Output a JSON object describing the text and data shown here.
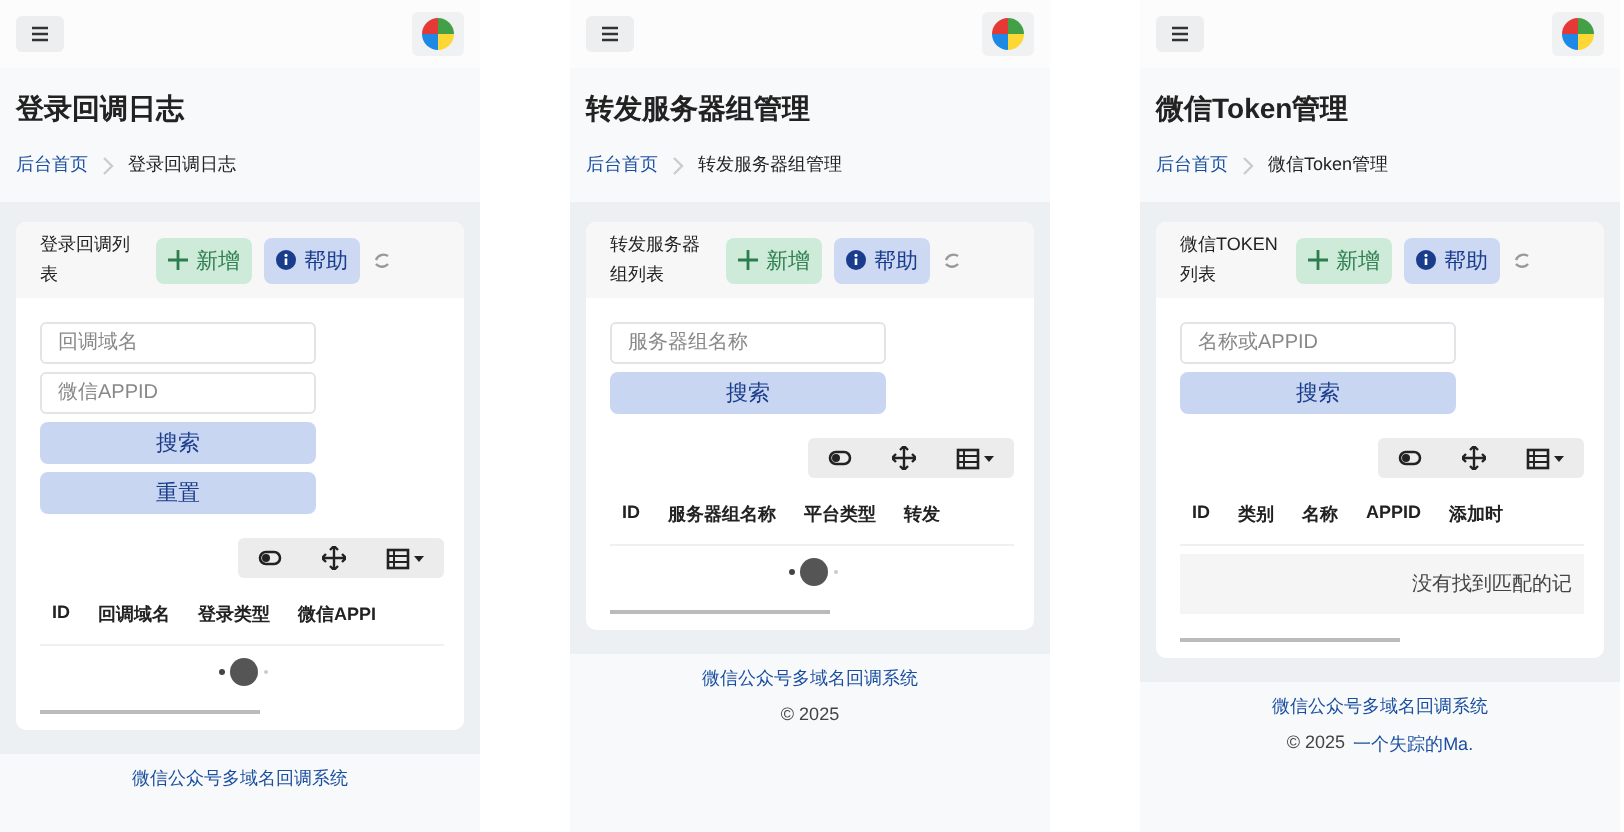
{
  "screens": [
    {
      "title": "登录回调日志",
      "breadcrumb": [
        {
          "label": "后台首页",
          "kind": "link"
        },
        {
          "label": "登录回调日志",
          "kind": "current"
        }
      ],
      "list_title": "登录回调列表",
      "add_button": "新增",
      "help_button": "帮助",
      "search_fields": [
        {
          "placeholder": "回调域名"
        },
        {
          "placeholder": "微信APPID"
        }
      ],
      "actions": [
        "搜索",
        "重置"
      ],
      "columns": [
        "ID",
        "回调域名",
        "登录类型",
        "微信APPI"
      ],
      "loading": true,
      "footer": [
        [
          {
            "text": "微信公众号多域名回调系统",
            "kind": "link"
          }
        ]
      ]
    },
    {
      "title": "转发服务器组管理",
      "breadcrumb": [
        {
          "label": "后台首页",
          "kind": "link"
        },
        {
          "label": "转发服务器组管理",
          "kind": "current"
        }
      ],
      "list_title": "转发服务器组列表",
      "add_button": "新增",
      "help_button": "帮助",
      "search_fields": [
        {
          "placeholder": "服务器组名称"
        }
      ],
      "actions": [
        "搜索"
      ],
      "columns": [
        "ID",
        "服务器组名称",
        "平台类型",
        "转发"
      ],
      "loading": true,
      "footer": [
        [
          {
            "text": "微信公众号多域名回调系统",
            "kind": "link"
          }
        ],
        [
          {
            "text": "© 2025",
            "kind": "text"
          }
        ]
      ]
    },
    {
      "title": "微信Token管理",
      "breadcrumb": [
        {
          "label": "后台首页",
          "kind": "link"
        },
        {
          "label": "微信Token管理",
          "kind": "current"
        }
      ],
      "list_title": "微信TOKEN列表",
      "add_button": "新增",
      "help_button": "帮助",
      "search_fields": [
        {
          "placeholder": "名称或APPID"
        }
      ],
      "actions": [
        "搜索"
      ],
      "columns": [
        "ID",
        "类别",
        "名称",
        "APPID",
        "添加时"
      ],
      "empty_message": "没有找到匹配的记",
      "footer": [
        [
          {
            "text": "微信公众号多域名回调系统",
            "kind": "link"
          }
        ],
        [
          {
            "text": "© 2025",
            "kind": "text"
          },
          {
            "text": "一个失踪的Ma.",
            "kind": "link"
          }
        ]
      ]
    }
  ]
}
